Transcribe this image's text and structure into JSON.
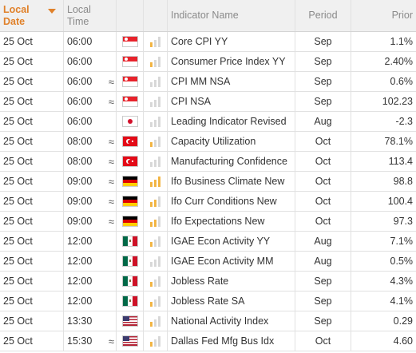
{
  "headers": {
    "date": "Local Date",
    "time": "Local Time",
    "name": "Indicator Name",
    "period": "Period",
    "prior": "Prior"
  },
  "rows": [
    {
      "date": "25 Oct",
      "time": "06:00",
      "approx": "",
      "country": "sg",
      "icon": "singapore-flag-icon",
      "imp": 1,
      "name": "Core CPI YY",
      "period": "Sep",
      "prior": "1.1%"
    },
    {
      "date": "25 Oct",
      "time": "06:00",
      "approx": "",
      "country": "sg",
      "icon": "singapore-flag-icon",
      "imp": 1,
      "name": "Consumer Price Index YY",
      "period": "Sep",
      "prior": "2.40%"
    },
    {
      "date": "25 Oct",
      "time": "06:00",
      "approx": "≈",
      "country": "sg",
      "icon": "singapore-flag-icon",
      "imp": 0,
      "name": "CPI MM NSA",
      "period": "Sep",
      "prior": "0.6%"
    },
    {
      "date": "25 Oct",
      "time": "06:00",
      "approx": "≈",
      "country": "sg",
      "icon": "singapore-flag-icon",
      "imp": 0,
      "name": "CPI NSA",
      "period": "Sep",
      "prior": "102.23"
    },
    {
      "date": "25 Oct",
      "time": "06:00",
      "approx": "",
      "country": "jp",
      "icon": "japan-flag-icon",
      "imp": 0,
      "name": "Leading Indicator Revised",
      "period": "Aug",
      "prior": "-2.3"
    },
    {
      "date": "25 Oct",
      "time": "08:00",
      "approx": "≈",
      "country": "tr",
      "icon": "turkey-flag-icon",
      "imp": 1,
      "name": "Capacity Utilization",
      "period": "Oct",
      "prior": "78.1%"
    },
    {
      "date": "25 Oct",
      "time": "08:00",
      "approx": "≈",
      "country": "tr",
      "icon": "turkey-flag-icon",
      "imp": 0,
      "name": "Manufacturing Confidence",
      "period": "Oct",
      "prior": "113.4"
    },
    {
      "date": "25 Oct",
      "time": "09:00",
      "approx": "≈",
      "country": "de",
      "icon": "germany-flag-icon",
      "imp": 3,
      "name": "Ifo Business Climate New",
      "period": "Oct",
      "prior": "98.8"
    },
    {
      "date": "25 Oct",
      "time": "09:00",
      "approx": "≈",
      "country": "de",
      "icon": "germany-flag-icon",
      "imp": 2,
      "name": "Ifo Curr Conditions New",
      "period": "Oct",
      "prior": "100.4"
    },
    {
      "date": "25 Oct",
      "time": "09:00",
      "approx": "≈",
      "country": "de",
      "icon": "germany-flag-icon",
      "imp": 2,
      "name": "Ifo Expectations New",
      "period": "Oct",
      "prior": "97.3"
    },
    {
      "date": "25 Oct",
      "time": "12:00",
      "approx": "",
      "country": "mx",
      "icon": "mexico-flag-icon",
      "imp": 1,
      "name": "IGAE Econ Activity YY",
      "period": "Aug",
      "prior": "7.1%"
    },
    {
      "date": "25 Oct",
      "time": "12:00",
      "approx": "",
      "country": "mx",
      "icon": "mexico-flag-icon",
      "imp": 0,
      "name": "IGAE Econ Activity MM",
      "period": "Aug",
      "prior": "0.5%"
    },
    {
      "date": "25 Oct",
      "time": "12:00",
      "approx": "",
      "country": "mx",
      "icon": "mexico-flag-icon",
      "imp": 1,
      "name": "Jobless Rate",
      "period": "Sep",
      "prior": "4.3%"
    },
    {
      "date": "25 Oct",
      "time": "12:00",
      "approx": "",
      "country": "mx",
      "icon": "mexico-flag-icon",
      "imp": 1,
      "name": "Jobless Rate SA",
      "period": "Sep",
      "prior": "4.1%"
    },
    {
      "date": "25 Oct",
      "time": "13:30",
      "approx": "",
      "country": "us",
      "icon": "usa-flag-icon",
      "imp": 1,
      "name": "National Activity Index",
      "period": "Sep",
      "prior": "0.29"
    },
    {
      "date": "25 Oct",
      "time": "15:30",
      "approx": "≈",
      "country": "us",
      "icon": "usa-flag-icon",
      "imp": 1,
      "name": "Dallas Fed Mfg Bus Idx",
      "period": "Oct",
      "prior": "4.60"
    }
  ]
}
